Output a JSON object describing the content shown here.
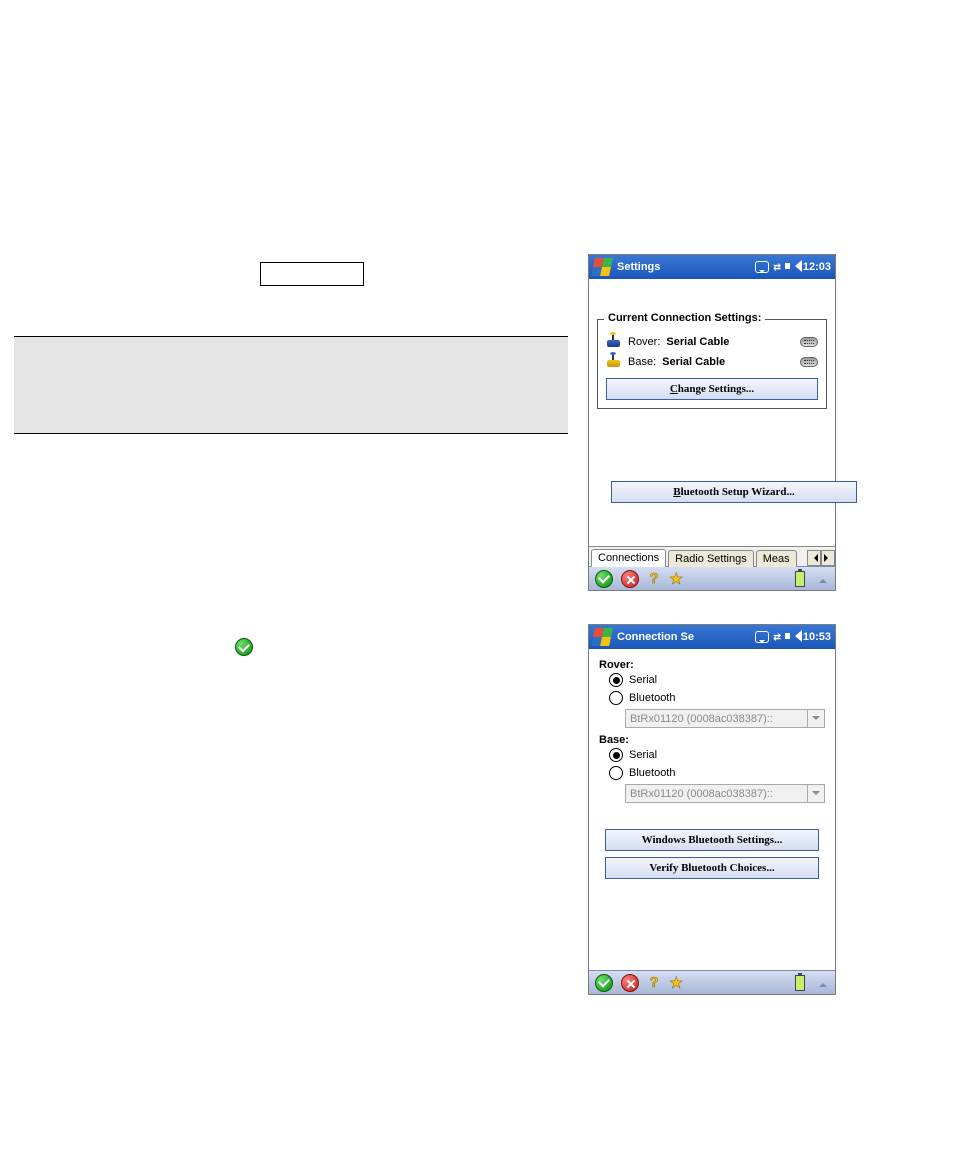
{
  "settings_window": {
    "title": "Settings",
    "clock": "12:03",
    "fieldset_legend": "Current Connection Settings:",
    "rover_label": "Rover:",
    "rover_value": "Serial Cable",
    "base_label": "Base:",
    "base_value": "Serial Cable",
    "change_settings_prefix": "",
    "change_settings_underline": "C",
    "change_settings_rest": "hange Settings...",
    "bt_wizard_underline": "B",
    "bt_wizard_rest": "luetooth Setup Wizard...",
    "tabs": {
      "connections": "Connections",
      "radio_settings": "Radio Settings",
      "measure": "Meas"
    }
  },
  "connection_window": {
    "title": "Connection Se",
    "clock": "10:53",
    "rover_label": "Rover:",
    "base_label": "Base:",
    "option_serial": "Serial",
    "option_bluetooth": "Bluetooth",
    "combo_value": "BtRx01120 (0008ac038387)::",
    "windows_bt_label": "Windows Bluetooth Settings...",
    "verify_bt_label": "Verify Bluetooth Choices..."
  }
}
